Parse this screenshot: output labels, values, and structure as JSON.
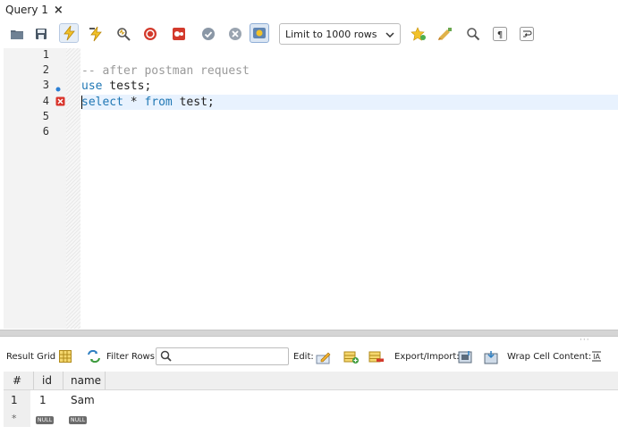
{
  "tab": {
    "title": "Query 1",
    "close_glyph": "×"
  },
  "toolbar": {
    "limit_label": "Limit to 1000 rows",
    "buttons": [
      "open-folder-icon",
      "save-icon",
      "execute-icon",
      "execute-current-icon",
      "explain-icon",
      "stop-icon",
      "toggle-error-icon",
      "commit-icon",
      "rollback-icon",
      "autocommit-icon",
      "add-snippet-icon",
      "beautify-icon",
      "find-icon",
      "invisibles-icon",
      "wrap-icon"
    ]
  },
  "editor": {
    "line_numbers": [
      "1",
      "2",
      "3",
      "4",
      "5",
      "6"
    ],
    "lines": {
      "l2": "-- after postman request",
      "l3_kw": "use",
      "l3_rest": " tests;",
      "l4_kw1": "select",
      "l4_mid": " * ",
      "l4_kw2": "from",
      "l4_rest": " test;"
    }
  },
  "results": {
    "result_grid_label": "Result Grid",
    "filter_rows_label": "Filter Rows:",
    "edit_label": "Edit:",
    "export_label": "Export/Import:",
    "wrap_label": "Wrap Cell Content:",
    "columns": [
      "#",
      "id",
      "name"
    ],
    "rows": [
      {
        "num": "1",
        "id": "1",
        "name": "Sam"
      }
    ],
    "new_row_marker": "*",
    "null_label": "NULL"
  },
  "colors": {
    "keyword": "#1f77b4",
    "comment": "#9a9a9a",
    "current_line": "#e8f2fe",
    "error_marker": "#d9342b",
    "info_marker": "#2a7fd4"
  }
}
